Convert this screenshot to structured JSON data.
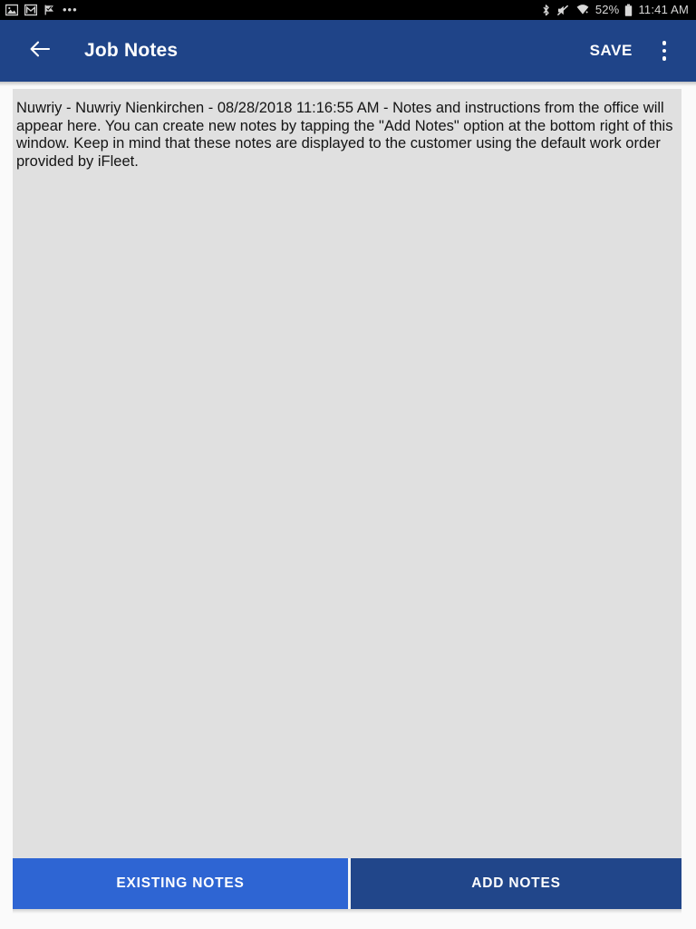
{
  "status_bar": {
    "left_icons": [
      {
        "name": "photo-icon",
        "label": "Photo"
      },
      {
        "name": "gmail-icon",
        "label": "Gmail"
      },
      {
        "name": "flag-check-icon",
        "label": "Task"
      }
    ],
    "overflow_indicator": "•••",
    "right_icons": [
      {
        "name": "bluetooth-icon",
        "label": "Bluetooth"
      },
      {
        "name": "mute-icon",
        "label": "Sound off"
      },
      {
        "name": "wifi-icon",
        "label": "Wi-Fi"
      }
    ],
    "battery_percent": "52%",
    "battery_icon": "battery-icon",
    "clock": "11:41 AM"
  },
  "app_bar": {
    "back_icon": "arrow-back-icon",
    "title": "Job Notes",
    "save_label": "SAVE",
    "overflow_icon": "more-vert-icon"
  },
  "notes": {
    "body": "Nuwriy - Nuwriy Nienkirchen - 08/28/2018 11:16:55 AM - Notes and instructions from the office will appear here. You can create new notes by tapping the \"Add Notes\" option at the bottom right of this window. Keep in mind that these notes are displayed to the customer using the default work order provided by iFleet."
  },
  "bottom_tabs": {
    "existing_label": "EXISTING NOTES",
    "add_label": "ADD NOTES"
  },
  "colors": {
    "app_bar": "#1f4488",
    "existing_tab": "#2e65d3",
    "add_tab": "#21468a",
    "content_bg": "#e0e0e0",
    "page_bg": "#fafafa",
    "status_bar": "#000000"
  }
}
